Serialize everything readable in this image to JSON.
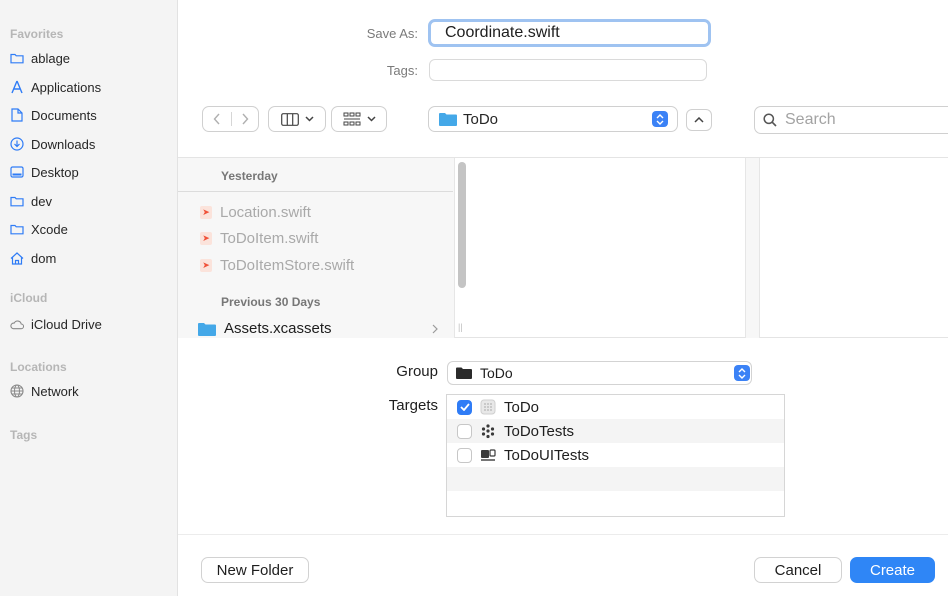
{
  "sidebar": {
    "favorites_title": "Favorites",
    "favorites": [
      {
        "label": "ablage",
        "icon": "folder-icon"
      },
      {
        "label": "Applications",
        "icon": "applications-icon"
      },
      {
        "label": "Documents",
        "icon": "document-icon"
      },
      {
        "label": "Downloads",
        "icon": "download-icon"
      },
      {
        "label": "Desktop",
        "icon": "desktop-icon"
      },
      {
        "label": "dev",
        "icon": "folder-icon"
      },
      {
        "label": "Xcode",
        "icon": "folder-icon"
      },
      {
        "label": "dom",
        "icon": "home-icon"
      }
    ],
    "icloud_title": "iCloud",
    "icloud": [
      {
        "label": "iCloud Drive",
        "icon": "cloud-icon"
      }
    ],
    "locations_title": "Locations",
    "locations": [
      {
        "label": "Network",
        "icon": "globe-icon"
      }
    ],
    "tags_title": "Tags"
  },
  "form": {
    "save_as_label": "Save As:",
    "save_as_value": "Coordinate.swift",
    "tags_label": "Tags:",
    "tags_value": ""
  },
  "toolbar": {
    "location": "ToDo",
    "search_placeholder": "Search"
  },
  "browser": {
    "yesterday_title": "Yesterday",
    "files": [
      "Location.swift",
      "ToDoItem.swift",
      "ToDoItemStore.swift"
    ],
    "previous_title": "Previous 30 Days",
    "folders": [
      "Assets.xcassets"
    ]
  },
  "options": {
    "group_label": "Group",
    "group_value": "ToDo",
    "targets_label": "Targets",
    "targets": [
      {
        "label": "ToDo",
        "checked": true
      },
      {
        "label": "ToDoTests",
        "checked": false
      },
      {
        "label": "ToDoUITests",
        "checked": false
      }
    ]
  },
  "buttons": {
    "new_folder": "New Folder",
    "cancel": "Cancel",
    "create": "Create"
  },
  "colors": {
    "accent": "#2f86f6",
    "folder": "#44a8e8",
    "sidebar_icon": "#2f7cf6"
  }
}
